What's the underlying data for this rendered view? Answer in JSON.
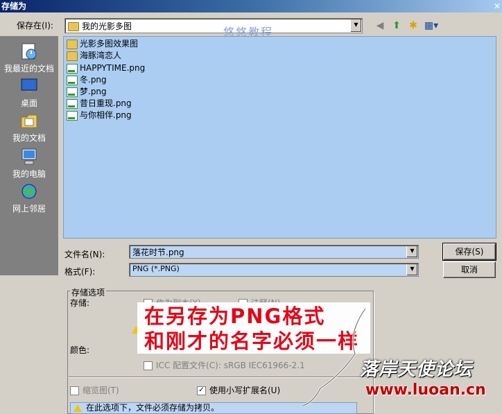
{
  "window": {
    "title": "存储为"
  },
  "top": {
    "save_in_label": "保存在(I):",
    "save_in_value": "我的光影多图",
    "watermark_top": "悠悠教程"
  },
  "places": [
    {
      "label": "我最近的文档",
      "icon": "recent-documents-icon"
    },
    {
      "label": "桌面",
      "icon": "desktop-icon"
    },
    {
      "label": "我的文档",
      "icon": "my-documents-icon"
    },
    {
      "label": "我的电脑",
      "icon": "my-computer-icon"
    },
    {
      "label": "网上邻居",
      "icon": "network-places-icon"
    }
  ],
  "files": [
    {
      "name": "光影多图效果图",
      "type": "folder"
    },
    {
      "name": "海豚湾恋人",
      "type": "folder"
    },
    {
      "name": "HAPPYTIME.png",
      "type": "png"
    },
    {
      "name": "冬.png",
      "type": "png"
    },
    {
      "name": "梦.png",
      "type": "png"
    },
    {
      "name": "昔日重现.png",
      "type": "png"
    },
    {
      "name": "与你相伴.png",
      "type": "png"
    }
  ],
  "form": {
    "filename_label": "文件名(N):",
    "filename_value": "落花时节.png",
    "format_label": "格式(F):",
    "format_value": "PNG (*.PNG)",
    "save_button": "保存(S)",
    "cancel_button": "取消"
  },
  "options": {
    "group_label": "存储选项",
    "store_label": "存储:",
    "as_copy": "作为副本(Y)",
    "annotations": "注释(N)",
    "color_label": "颜色:",
    "icc_profile": "ICC 配置文件(C): sRGB IEC61966-2.1",
    "thumbnail": "缩览图(T)",
    "lowercase_ext": "使用小写扩展名(U)",
    "warning": "在此选项下，文件必须存储为拷贝。"
  },
  "overlay": {
    "line1": "在另存为PNG格式",
    "line2": "和刚才的名字必须一样"
  },
  "watermark": {
    "site_name": "落岸天使论坛",
    "url": "www.luoan.cn"
  }
}
